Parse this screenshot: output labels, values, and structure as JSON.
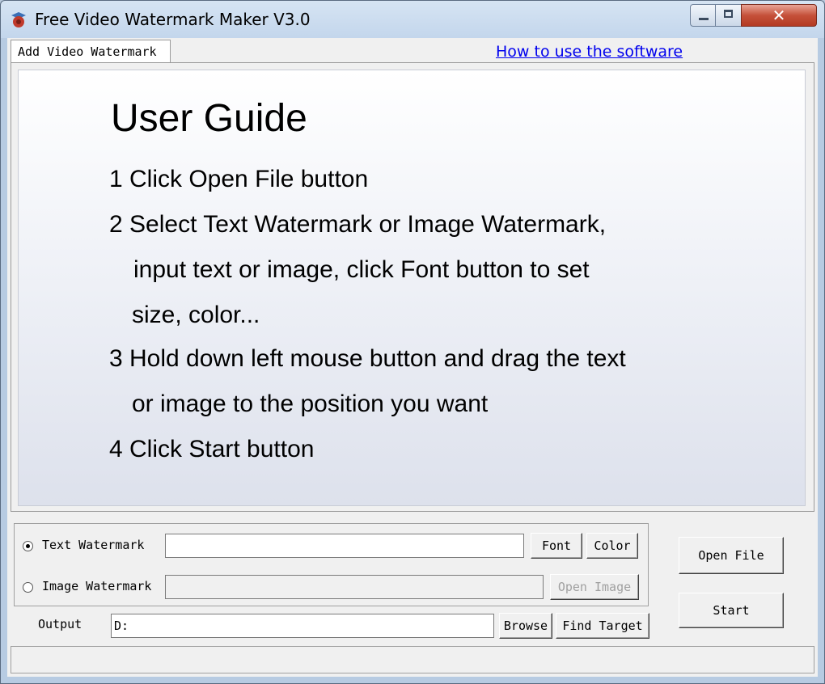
{
  "window": {
    "title": "Free Video Watermark Maker V3.0",
    "close_glyph": "✕"
  },
  "tab": {
    "label": "Add Video Watermark"
  },
  "help_link": "How to use the software",
  "guide": {
    "title": "User Guide",
    "lines": [
      "1 Click Open File button",
      "2 Select Text Watermark or Image Watermark,",
      "input text or image, click Font button to set",
      "size,  color...",
      "3 Hold down left mouse button and drag the text",
      "or image to the position you want",
      "4 Click Start button"
    ]
  },
  "watermark": {
    "text_label": "Text Watermark",
    "text_value": "",
    "text_selected": true,
    "font_button": "Font",
    "color_button": "Color",
    "image_label": "Image Watermark",
    "image_value": "",
    "open_image_button": "Open Image"
  },
  "output": {
    "label": "Output",
    "value": "D:",
    "browse_button": "Browse",
    "find_target_button": "Find Target"
  },
  "actions": {
    "open_file": "Open File",
    "start": "Start"
  },
  "icons": {
    "app": "app-icon",
    "minimize": "minimize-icon",
    "maximize": "maximize-icon",
    "close": "close-icon"
  }
}
